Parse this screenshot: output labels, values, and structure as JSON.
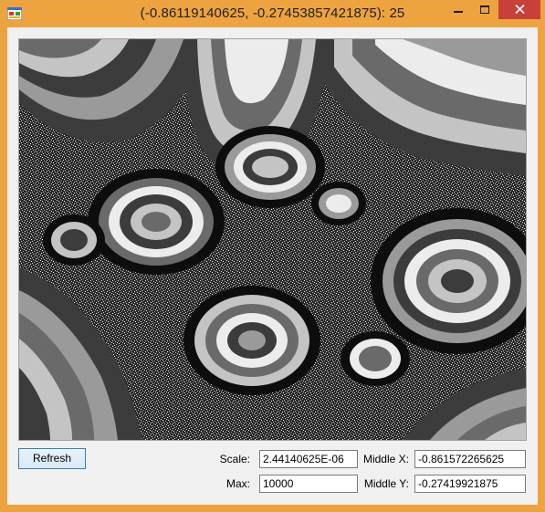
{
  "window": {
    "title": "(-0.86119140625, -0.27453857421875): 25"
  },
  "toolbar": {
    "refresh_label": "Refresh"
  },
  "fields": {
    "scale_label": "Scale:",
    "scale_value": "2.44140625E-06",
    "max_label": "Max:",
    "max_value": "10000",
    "middle_x_label": "Middle X:",
    "middle_x_value": "-0.861572265625",
    "middle_y_label": "Middle Y:",
    "middle_y_value": "-0.27419921875"
  },
  "colors": {
    "title_bar": "#eda33f",
    "close_button": "#c7403a",
    "fractal_palette": [
      "#0d0d0d",
      "#3c3c3c",
      "#6a6a6a",
      "#9a9a9a",
      "#c4c4c4",
      "#ececec"
    ]
  },
  "icons": {
    "app": "app-icon",
    "minimize": "minimize-icon",
    "maximize": "maximize-icon",
    "close": "close-icon"
  }
}
